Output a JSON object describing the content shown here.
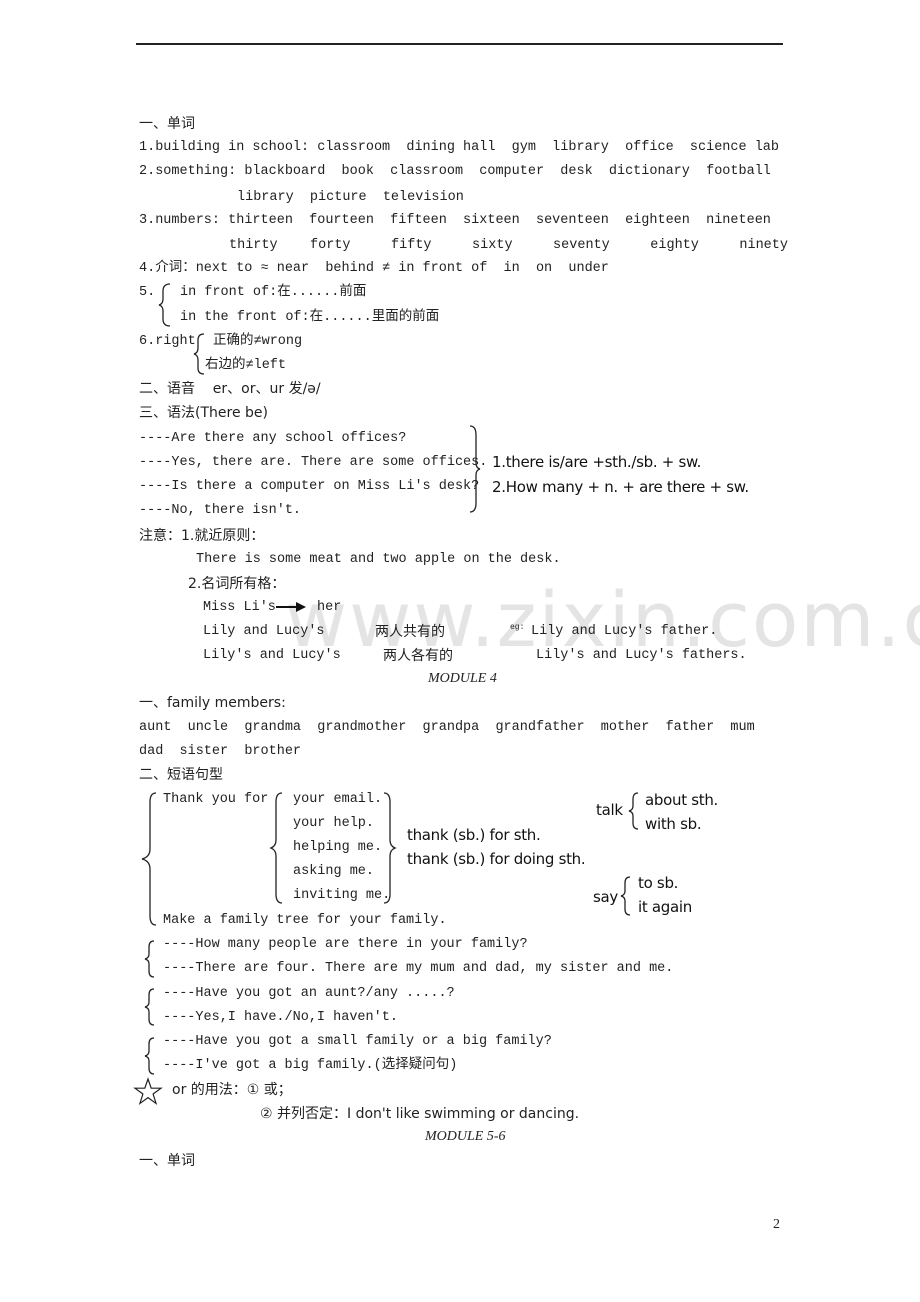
{
  "watermark": "www.zixin.com.cn",
  "vocab": {
    "heading": "一、单词",
    "line1": "1.building in school: classroom  dining hall  gym  library  office  science lab",
    "line2a": "2.something: blackboard  book  classroom  computer  desk  dictionary  football",
    "line2b": "library  picture  television",
    "line3a": "3.numbers: thirteen  fourteen  fifteen  sixteen  seventeen  eighteen  nineteen",
    "line3b": "thirty    forty     fifty     sixty     seventy     eighty     ninety",
    "line4": "4.介词：next to ≈ near  behind ≠ in front of  in  on  under",
    "line5_num": "5.",
    "line5a": "in front of:在......前面",
    "line5b": "in the front of:在......里面的前面",
    "line6_num": "6.right",
    "line6a": "正确的≠wrong",
    "line6b": "右边的≠left"
  },
  "phonetics": {
    "heading": "二、语音    er、or、ur 发/ə/"
  },
  "grammar": {
    "heading": "三、语法(There be)",
    "dialog": [
      "----Are there any school offices?",
      "----Yes, there are. There are some offices.",
      "----Is there a computer on Miss Li's desk?",
      "----No, there isn't."
    ],
    "rules": [
      "1.there is/are +sth./sb. + sw.",
      "2.How many + n. + are there + sw."
    ],
    "note_heading": "注意：1.就近原则：",
    "note_example": "There is some meat and two apple on the desk.",
    "possessive_heading": "2.名词所有格：",
    "possessive_line1a": "Miss Li's",
    "possessive_line1b": "her",
    "possessive_rows": [
      {
        "left": "Lily and Lucy's",
        "meaning": "两人共有的",
        "eg_label": "eg:",
        "example": "Lily and Lucy's father."
      },
      {
        "left": "Lily's and Lucy's",
        "meaning": "两人各有的",
        "eg_label": "",
        "example": "Lily's and Lucy's fathers."
      }
    ]
  },
  "module4": {
    "title": "MODULE 4",
    "family_heading": "一、family members:",
    "family_line1": "aunt  uncle  grandma  grandmother  grandpa  grandfather  mother  father  mum",
    "family_line2": "dad  sister  brother",
    "phrases_heading": "二、短语句型",
    "thank_you_for": "Thank you for",
    "thank_objects": [
      "your email.",
      "your help.",
      "helping me.",
      "asking me.",
      "inviting me."
    ],
    "thank_rules": [
      "thank (sb.) for sth.",
      "thank (sb.) for doing sth."
    ],
    "talk": {
      "verb": "talk",
      "items": [
        "about sth.",
        "with sb."
      ]
    },
    "say": {
      "verb": "say",
      "items": [
        "to sb.",
        "it again"
      ]
    },
    "family_tree": "Make a family tree for your family.",
    "dialogs": [
      [
        "----How many people are there in your family?",
        "----There are four. There are my mum and dad, my sister and me."
      ],
      [
        "----Have you got an aunt?/any .....?",
        "----Yes,I have./No,I haven't."
      ],
      [
        "----Have you got a small family or a big family?",
        "----I've got a big family.(选择疑问句)"
      ]
    ],
    "or_usage_1": "or 的用法：① 或；",
    "or_usage_2": "② 并列否定：I don't like swimming or dancing."
  },
  "module56": {
    "title": "MODULE 5-6",
    "heading": "一、单词"
  },
  "page_number": "2"
}
